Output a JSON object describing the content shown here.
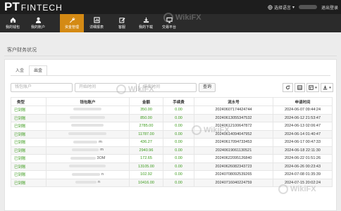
{
  "brand": {
    "logo_main": "PT",
    "logo_sub": "FINTECH"
  },
  "header": {
    "language": "选择语言",
    "logout": "退出登录"
  },
  "nav": [
    {
      "label": "我的钱包",
      "icon": "home-icon",
      "active": false
    },
    {
      "label": "我的账户",
      "icon": "user-icon",
      "active": false
    },
    {
      "label": "资金管理",
      "icon": "wrench-icon",
      "active": true
    },
    {
      "label": "详细报表",
      "icon": "report-icon",
      "active": false
    },
    {
      "label": "客服",
      "icon": "edit-icon",
      "active": false
    },
    {
      "label": "我的下载",
      "icon": "download-icon",
      "active": false
    },
    {
      "label": "交易平台",
      "icon": "desktop-icon",
      "active": false
    }
  ],
  "page": {
    "title": "客户财务状况"
  },
  "tabs": [
    "入金",
    "出金"
  ],
  "filters": {
    "account_placeholder": "钱包账户",
    "start_placeholder": "开始时间",
    "end_placeholder": "结束时间",
    "search_label": "查询"
  },
  "table": {
    "headers": [
      "类型",
      "钱包账户",
      "金额",
      "手续费",
      "流水号",
      "申请时间"
    ],
    "rows": [
      {
        "type": "已到账",
        "account": "",
        "amount": "350.00",
        "fee": "0.00",
        "serial": "20240607174424744",
        "time": "2024-06-07 09:44:24"
      },
      {
        "type": "已到账",
        "account": "",
        "amount": "850.00",
        "fee": "0.00",
        "serial": "20240613055347532",
        "time": "2024-06-12 21:53:47"
      },
      {
        "type": "已到账",
        "account": "",
        "amount": "2785.00",
        "fee": "0.00",
        "serial": "20240612100647872",
        "time": "2024-06-13 02:06:47"
      },
      {
        "type": "已到账",
        "account": "",
        "amount": "11787.00",
        "fee": "0.00",
        "serial": "20240614094047952",
        "time": "2024-06-14 01:40:47"
      },
      {
        "type": "已到账",
        "account": "m",
        "amount": "436.27",
        "fee": "0.00",
        "serial": "20240617094733453",
        "time": "2024-06-17 00:47:33"
      },
      {
        "type": "已到账",
        "account": "m",
        "amount": "2940.96",
        "fee": "0.00",
        "serial": "20240619061130521",
        "time": "2024-06-18 22:11:30"
      },
      {
        "type": "已到账",
        "account": "3OM",
        "amount": "172.65",
        "fee": "0.00",
        "serial": "20240622095126840",
        "time": "2024-06-22 01:51:26"
      },
      {
        "type": "已到账",
        "account": "",
        "amount": "13105.00",
        "fee": "0.00",
        "serial": "20240626082343723",
        "time": "2024-06-26 00:23:43"
      },
      {
        "type": "已到账",
        "account": "n",
        "amount": "102.92",
        "fee": "0.00",
        "serial": "20240708092539265",
        "time": "2024-07-08 01:35:39"
      },
      {
        "type": "已到账",
        "account": "n",
        "amount": "10416.00",
        "fee": "0.00",
        "serial": "20240716040224759",
        "time": "2024-07-15 20:02:24"
      }
    ]
  },
  "watermark": "WikiFX"
}
